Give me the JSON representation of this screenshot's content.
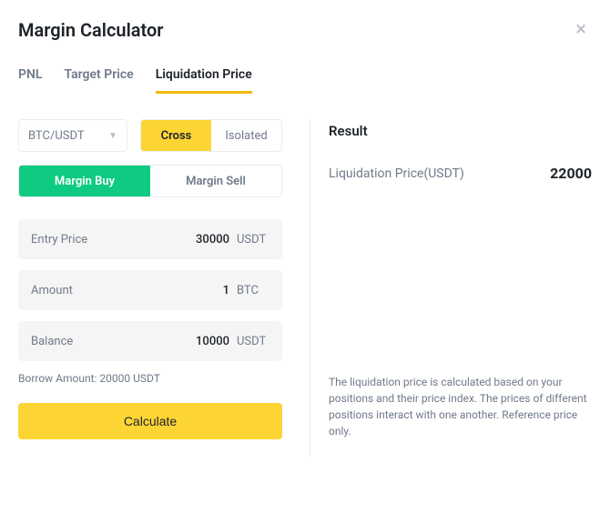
{
  "header": {
    "title": "Margin Calculator",
    "close_icon": "×"
  },
  "tabs": [
    {
      "label": "PNL",
      "active": false
    },
    {
      "label": "Target Price",
      "active": false
    },
    {
      "label": "Liquidation Price",
      "active": true
    }
  ],
  "form": {
    "pair": "BTC/USDT",
    "mode": {
      "cross": "Cross",
      "isolated": "Isolated"
    },
    "side": {
      "buy": "Margin Buy",
      "sell": "Margin Sell"
    },
    "fields": {
      "entry": {
        "label": "Entry Price",
        "value": "30000",
        "unit": "USDT"
      },
      "amount": {
        "label": "Amount",
        "value": "1",
        "unit": "BTC"
      },
      "balance": {
        "label": "Balance",
        "value": "10000",
        "unit": "USDT"
      }
    },
    "borrow_line": "Borrow Amount: 20000 USDT",
    "calculate_label": "Calculate"
  },
  "result": {
    "title": "Result",
    "liq_label": "Liquidation Price(USDT)",
    "liq_value": "22000",
    "disclaimer": "The liquidation price is calculated based on your positions and their price index. The prices of different positions interact with one another. Reference price only."
  }
}
